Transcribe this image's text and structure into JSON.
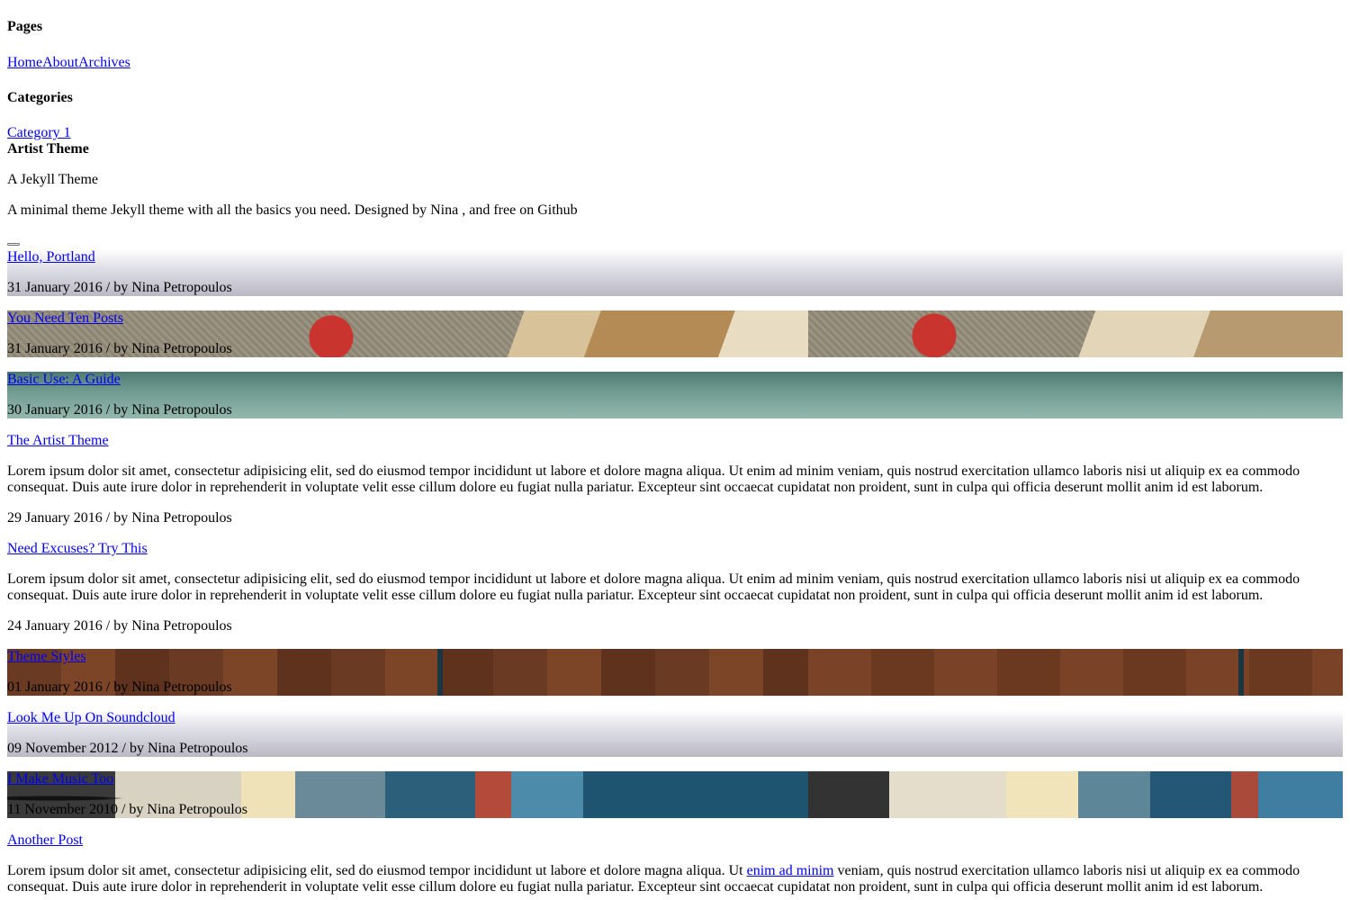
{
  "sidebar": {
    "pages_heading": "Pages",
    "pages": [
      "Home",
      "About",
      "Archives"
    ],
    "categories_heading": "Categories",
    "categories": [
      "Category 1"
    ]
  },
  "site": {
    "title": "Artist Theme",
    "tagline": "A Jekyll Theme",
    "description": "A minimal theme Jekyll theme with all the basics you need. Designed by Nina , and free on Github"
  },
  "posts": [
    {
      "title": "Hello, Portland",
      "meta": "31 January 2016 / by Nina Petropoulos"
    },
    {
      "title": "You Need Ten Posts",
      "meta": "31 January 2016 / by Nina Petropoulos"
    },
    {
      "title": "Basic Use: A Guide",
      "meta": "30 January 2016 / by Nina Petropoulos"
    },
    {
      "title": "The Artist Theme",
      "excerpt": "Lorem ipsum dolor sit amet, consectetur adipisicing elit, sed do eiusmod tempor incididunt ut labore et dolore magna aliqua. Ut enim ad minim veniam, quis nostrud exercitation ullamco laboris nisi ut aliquip ex ea commodo consequat. Duis aute irure dolor in reprehenderit in voluptate velit esse cillum dolore eu fugiat nulla pariatur. Excepteur sint occaecat cupidatat non proident, sunt in culpa qui officia deserunt mollit anim id est laborum.",
      "meta": "29 January 2016 / by Nina Petropoulos"
    },
    {
      "title": "Need Excuses? Try This",
      "excerpt": "Lorem ipsum dolor sit amet, consectetur adipisicing elit, sed do eiusmod tempor incididunt ut labore et dolore magna aliqua. Ut enim ad minim veniam, quis nostrud exercitation ullamco laboris nisi ut aliquip ex ea commodo consequat. Duis aute irure dolor in reprehenderit in voluptate velit esse cillum dolore eu fugiat nulla pariatur. Excepteur sint occaecat cupidatat non proident, sunt in culpa qui officia deserunt mollit anim id est laborum.",
      "meta": "24 January 2016 / by Nina Petropoulos"
    },
    {
      "title": "Theme Styles",
      "meta": "01 January 2016 / by Nina Petropoulos"
    },
    {
      "title": "Look Me Up On Soundcloud",
      "meta": "09 November 2012 / by Nina Petropoulos"
    },
    {
      "title": "I Make Music Too",
      "meta": "11 November 2010 / by Nina Petropoulos"
    },
    {
      "title": "Another Post",
      "excerpt_before": "Lorem ipsum dolor sit amet, consectetur adipisicing elit, sed do eiusmod tempor incididunt ut labore et dolore magna aliqua. Ut ",
      "excerpt_link": "enim ad minim",
      "excerpt_after": " veniam, quis nostrud exercitation ullamco laboris nisi ut aliquip ex ea commodo consequat. Duis aute irure dolor in reprehenderit in voluptate velit esse cillum dolore eu fugiat nulla pariatur. Excepteur sint occaecat cupidatat non proident, sunt in culpa qui officia deserunt mollit anim id est laborum."
    }
  ]
}
